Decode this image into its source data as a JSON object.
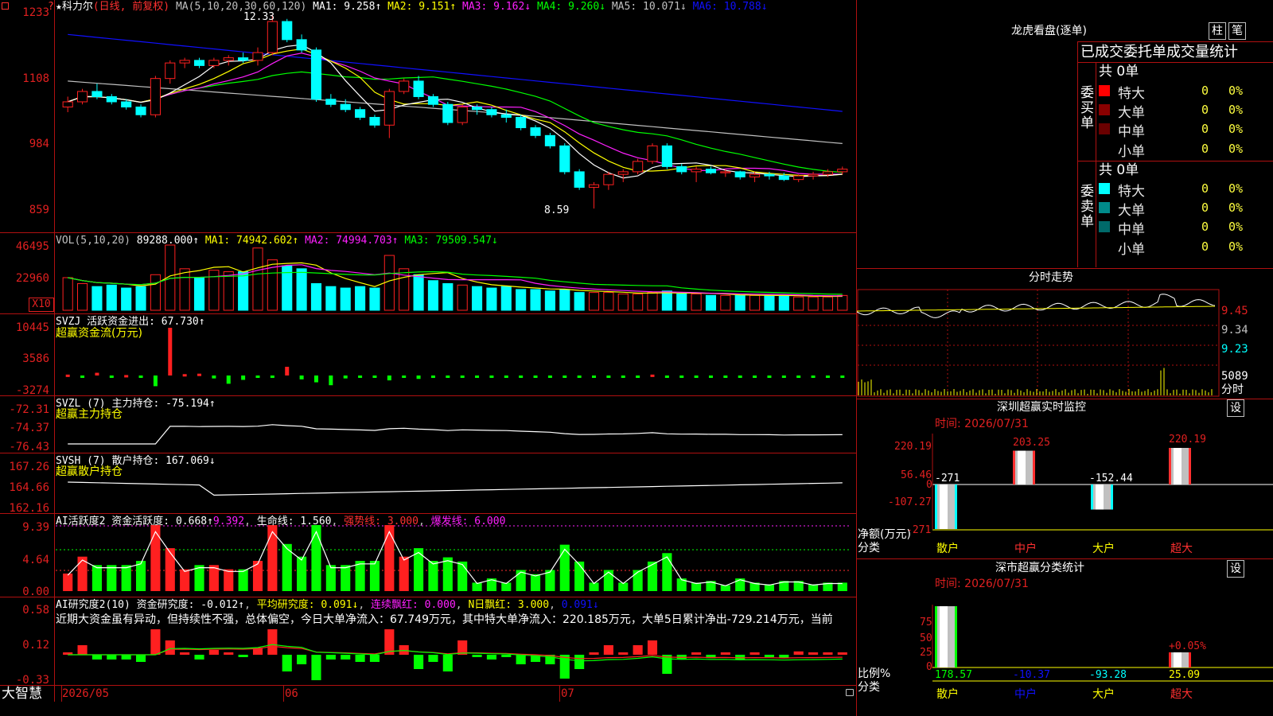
{
  "colors": {
    "up": "#ff2020",
    "down": "#00ffff",
    "grid": "#b01010",
    "yellow": "#ffff00",
    "magenta": "#ff20ff",
    "green": "#00ff00",
    "white": "#ffffff",
    "blue": "#1010ff"
  },
  "top_left": {
    "symbol_icon": "red-square-icon",
    "question": "?"
  },
  "price": {
    "title": "★科力尔",
    "period": "(日线, 前复权)",
    "ma_def": "MA(5,10,20,30,60,120)",
    "ma1": "MA1: 9.258↑",
    "ma2": "MA2: 9.151↑",
    "ma3": "MA3: 9.162↓",
    "ma4": "MA4: 9.260↓",
    "ma5": "MA5: 10.071↓",
    "ma6": "MA6: 10.788↓",
    "high_label": "12.33",
    "low_label": "8.59",
    "yticks": [
      "1233",
      "1108",
      "984",
      "859"
    ]
  },
  "vol": {
    "title": "VOL(5,10,20)",
    "value": "89288.000↑",
    "ma1": "MA1: 74942.602↑",
    "ma2": "MA2: 74994.703↑",
    "ma3": "MA3: 79509.547↓",
    "yticks": [
      "46495",
      "22960"
    ],
    "unit": "X10"
  },
  "svzj": {
    "title": "SVZJ  活跃资金进出: 67.730↑",
    "sub": "超赢资金流(万元)",
    "yticks": [
      "10445",
      "3586",
      "-3274"
    ]
  },
  "svzl": {
    "title": "SVZL (7) 主力持仓: -75.194↑",
    "sub": "超赢主力持仓",
    "yticks": [
      "-72.31",
      "-74.37",
      "-76.43"
    ]
  },
  "svsh": {
    "title": "SVSH (7) 散户持仓: 167.069↓",
    "sub": "超赢散户持仓",
    "yticks": [
      "167.26",
      "164.66",
      "162.16"
    ]
  },
  "ai_active": {
    "title": "AI活跃度2 资金活跃度: 0.668↑",
    "v2": "9.392",
    "life": "生命线: 1.560",
    "trend": "强势线: 3.000",
    "burst": "爆发线: 6.000",
    "yticks": [
      "9.39",
      "4.64",
      "0.00"
    ]
  },
  "ai_research": {
    "title": "AI研究度2(10) 资金研究度: -0.012↑",
    "avg": "平均研究度: 0.091↓",
    "streak_red": "连续飘红: 0.000",
    "n_red": "N日飘红: 3.000",
    "tail": "0.091↓",
    "comment": "近期大资金虽有异动，但持续性不强，总体偏空，今日大单净流入：67.749万元，其中特大单净流入：220.185万元，大单5日累计净出-729.214万元，当前",
    "yticks": [
      "0.58",
      "0.12",
      "-0.33"
    ]
  },
  "xaxis": {
    "logo": "大智慧",
    "labels": [
      "2026/05",
      "06",
      "07"
    ]
  },
  "dragon": {
    "title": "龙虎看盘(逐单)",
    "btn_col": "柱",
    "btn_pen": "笔",
    "table_title": "已成交委托单成交量统计",
    "buy_label": "委买单",
    "sell_label": "委卖单",
    "buy_total": "共 0单",
    "sell_total": "共 0单",
    "buy_rows": [
      {
        "name": "特大",
        "count": "0",
        "pct": "0%",
        "color": "#ff0000"
      },
      {
        "name": "大单",
        "count": "0",
        "pct": "0%",
        "color": "#8a0000"
      },
      {
        "name": "中单",
        "count": "0",
        "pct": "0%",
        "color": "#6a0000"
      },
      {
        "name": "小单",
        "count": "0",
        "pct": "0%",
        "color": "#000000"
      }
    ],
    "sell_rows": [
      {
        "name": "特大",
        "count": "0",
        "pct": "0%",
        "color": "#00ffff"
      },
      {
        "name": "大单",
        "count": "0",
        "pct": "0%",
        "color": "#008a8a"
      },
      {
        "name": "中单",
        "count": "0",
        "pct": "0%",
        "color": "#006a6a"
      },
      {
        "name": "小单",
        "count": "0",
        "pct": "0%",
        "color": "#000000"
      }
    ]
  },
  "intraday": {
    "title": "分时走势",
    "yticks": [
      "9.45",
      "9.34",
      "9.23"
    ],
    "vol_tick": "5089",
    "vol_unit": "分时"
  },
  "monitor": {
    "title": "深圳超赢实时监控",
    "btn": "设",
    "time": "时间: 2026/07/31",
    "yticks": [
      "220.19",
      "56.46",
      "0",
      "-107.27",
      "-271"
    ],
    "unit": "净额(万元)",
    "cat_label": "分类",
    "categories": [
      "散户",
      "中户",
      "大户",
      "超大"
    ],
    "bar_labels": [
      "-271",
      "203.25",
      "-152.44",
      "220.19"
    ],
    "bar_values": [
      -271,
      203.25,
      -152.44,
      220.19
    ]
  },
  "classify": {
    "title": "深市超赢分类统计",
    "btn": "设",
    "time": "时间: 2026/07/31",
    "yticks": [
      "75",
      "50",
      "25",
      "0"
    ],
    "unit": "比例%",
    "cat_label": "分类",
    "categories": [
      "散户",
      "中户",
      "大户",
      "超大"
    ],
    "values": [
      "178.57",
      "-10.37",
      "-93.28",
      "25.09"
    ],
    "note": "+0.05%"
  },
  "chart_data": [
    {
      "type": "candlestick",
      "title": "科力尔 日线 前复权",
      "ylim": [
        8.5,
        12.4
      ],
      "x": [
        "2026/05",
        "06",
        "07"
      ],
      "ohlc": [
        [
          10.55,
          10.75,
          10.45,
          10.65
        ],
        [
          10.65,
          10.9,
          10.6,
          10.85
        ],
        [
          10.85,
          11.0,
          10.7,
          10.75
        ],
        [
          10.75,
          10.8,
          10.6,
          10.65
        ],
        [
          10.65,
          10.7,
          10.5,
          10.55
        ],
        [
          10.55,
          10.6,
          10.35,
          10.4
        ],
        [
          10.4,
          11.15,
          10.35,
          11.1
        ],
        [
          11.1,
          11.45,
          11.0,
          11.4
        ],
        [
          11.4,
          11.5,
          11.3,
          11.45
        ],
        [
          11.45,
          11.5,
          11.3,
          11.35
        ],
        [
          11.35,
          11.5,
          11.3,
          11.45
        ],
        [
          11.45,
          11.55,
          11.35,
          11.5
        ],
        [
          11.5,
          11.6,
          11.4,
          11.45
        ],
        [
          11.45,
          11.7,
          11.35,
          11.6
        ],
        [
          11.6,
          12.33,
          11.55,
          12.2
        ],
        [
          12.2,
          12.25,
          11.8,
          11.85
        ],
        [
          11.85,
          11.95,
          11.6,
          11.65
        ],
        [
          11.65,
          11.7,
          10.65,
          10.7
        ],
        [
          10.7,
          10.8,
          10.55,
          10.6
        ],
        [
          10.6,
          10.7,
          10.45,
          10.5
        ],
        [
          10.5,
          10.55,
          10.3,
          10.35
        ],
        [
          10.35,
          10.4,
          10.15,
          10.2
        ],
        [
          10.2,
          10.9,
          9.95,
          10.85
        ],
        [
          10.85,
          11.1,
          10.8,
          11.05
        ],
        [
          11.05,
          11.15,
          10.7,
          10.75
        ],
        [
          10.75,
          10.8,
          10.55,
          10.6
        ],
        [
          10.6,
          10.65,
          10.2,
          10.25
        ],
        [
          10.25,
          10.6,
          10.2,
          10.55
        ],
        [
          10.55,
          10.6,
          10.4,
          10.5
        ],
        [
          10.5,
          10.55,
          10.35,
          10.4
        ],
        [
          10.4,
          10.5,
          10.25,
          10.35
        ],
        [
          10.35,
          10.4,
          10.1,
          10.15
        ],
        [
          10.15,
          10.2,
          9.95,
          10.0
        ],
        [
          10.0,
          10.05,
          9.75,
          9.8
        ],
        [
          9.8,
          9.85,
          9.25,
          9.3
        ],
        [
          9.3,
          9.35,
          8.95,
          9.0
        ],
        [
          9.0,
          9.1,
          8.59,
          9.05
        ],
        [
          9.05,
          9.3,
          8.95,
          9.25
        ],
        [
          9.25,
          9.35,
          9.1,
          9.3
        ],
        [
          9.3,
          9.55,
          9.25,
          9.5
        ],
        [
          9.5,
          9.85,
          9.45,
          9.8
        ],
        [
          9.8,
          9.85,
          9.35,
          9.4
        ],
        [
          9.4,
          9.45,
          9.25,
          9.3
        ],
        [
          9.3,
          9.4,
          9.1,
          9.35
        ],
        [
          9.35,
          9.4,
          9.25,
          9.28
        ],
        [
          9.28,
          9.35,
          9.2,
          9.3
        ],
        [
          9.3,
          9.32,
          9.15,
          9.2
        ],
        [
          9.2,
          9.3,
          9.1,
          9.25
        ],
        [
          9.25,
          9.3,
          9.15,
          9.22
        ],
        [
          9.22,
          9.28,
          9.12,
          9.15
        ],
        [
          9.15,
          9.25,
          9.1,
          9.22
        ],
        [
          9.22,
          9.3,
          9.15,
          9.25
        ],
        [
          9.25,
          9.35,
          9.2,
          9.3
        ],
        [
          9.3,
          9.4,
          9.25,
          9.35
        ]
      ]
    },
    {
      "type": "bar",
      "title": "VOL",
      "ylim": [
        0,
        46495
      ],
      "values": [
        2200,
        1800,
        1600,
        1700,
        1500,
        1600,
        2400,
        4400,
        2800,
        2200,
        2700,
        2600,
        2600,
        4200,
        3400,
        3000,
        2800,
        1800,
        1600,
        1500,
        1600,
        1500,
        3700,
        2800,
        2400,
        2000,
        1800,
        1700,
        1600,
        1500,
        1600,
        1400,
        1400,
        1300,
        1400,
        1200,
        1200,
        1200,
        1100,
        1100,
        1200,
        1300,
        1100,
        1100,
        1000,
        1000,
        1000,
        1000,
        1000,
        1000,
        900,
        900,
        900,
        1000
      ]
    },
    {
      "type": "bar",
      "title": "SVZJ 超赢资金流",
      "ylim": [
        -3274,
        10445
      ],
      "values": [
        200,
        -150,
        600,
        -300,
        100,
        -200,
        -2200,
        10445,
        300,
        400,
        -600,
        -1700,
        -900,
        -200,
        -500,
        1900,
        -800,
        -1400,
        -2000,
        -600,
        -400,
        -300,
        -1000,
        -400,
        -700,
        -500,
        -200,
        -100,
        -200,
        -300,
        -200,
        -100,
        -100,
        -150,
        -200,
        -100,
        -100,
        -100,
        -150,
        -100,
        200,
        -100,
        -100,
        -100,
        -100,
        -100,
        -100,
        -100,
        -100,
        -100,
        -100,
        -100,
        -100,
        -100
      ]
    }
  ]
}
